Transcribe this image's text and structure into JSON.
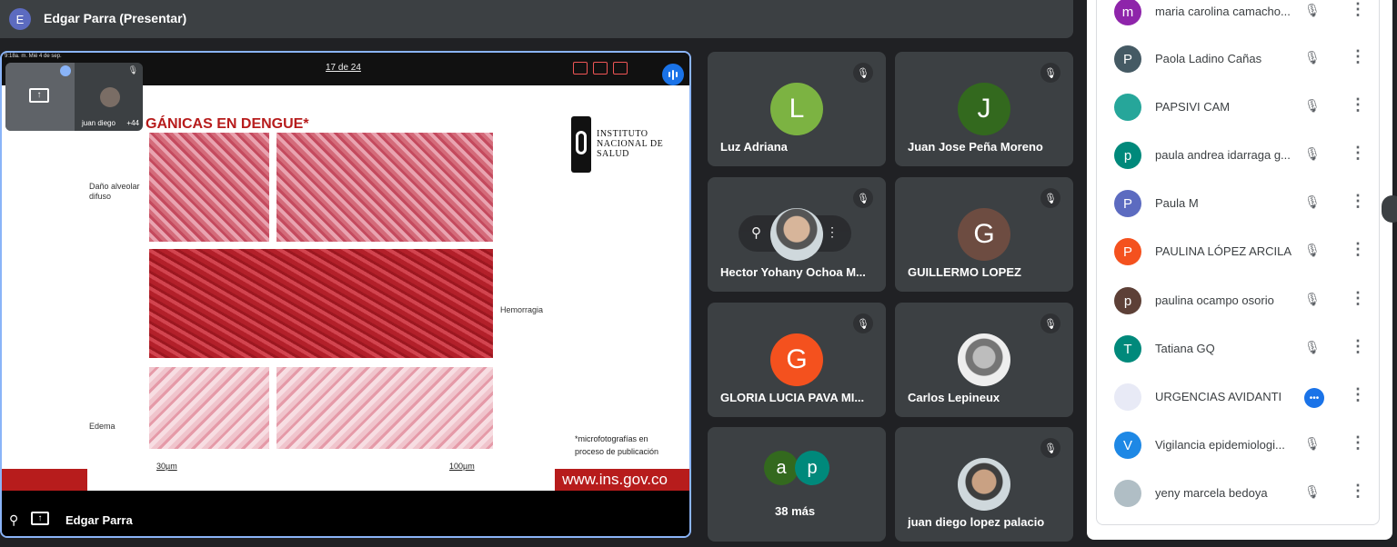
{
  "top_bar": {
    "avatar_letter": "E",
    "title": "Edgar Parra (Presentar)"
  },
  "presentation": {
    "device_time": "9:18a. m.   Mié 4 de sep.",
    "page_indicator": "17 de 24",
    "slide_title": "GÁNICAS EN DENGUE*",
    "logo_text": [
      "INSTITUTO",
      "NACIONAL DE",
      "SALUD"
    ],
    "annotations": {
      "dano": "Daño alveolar difuso",
      "hemorragia": "Hemorragia",
      "edema": "Edema"
    },
    "footnote": [
      "*microfotografías en",
      "proceso de publicación"
    ],
    "scale_left": "30µm",
    "scale_right": "100µm",
    "url": "www.ins.gov.co",
    "presenter_name": "Edgar Parra"
  },
  "self_view": {
    "label": "juan diego",
    "extra_count": "+44"
  },
  "tiles": [
    {
      "name": "Luz Adriana",
      "letter": "L",
      "color": "#7cb342"
    },
    {
      "name": "Juan Jose Peña Moreno",
      "letter": "J",
      "color": "#33691e"
    },
    {
      "name": "Hector Yohany Ochoa M...",
      "letter": "",
      "color": ""
    },
    {
      "name": "GUILLERMO LOPEZ",
      "letter": "G",
      "color": "#6d4c41"
    },
    {
      "name": "GLORIA LUCIA PAVA MI...",
      "letter": "G",
      "color": "#f4511e"
    },
    {
      "name": "Carlos Lepineux",
      "letter": "",
      "color": ""
    },
    {
      "name": "38 más",
      "letters": [
        "a",
        "p"
      ],
      "colors": [
        "#33691e",
        "#00897b"
      ]
    },
    {
      "name": "juan diego lopez palacio",
      "letter": "",
      "color": ""
    }
  ],
  "participants": [
    {
      "name": "maria carolina camacho...",
      "letter": "m",
      "color": "#8e24aa",
      "state": "muted"
    },
    {
      "name": "Paola Ladino Cañas",
      "letter": "P",
      "color": "#455a64",
      "state": "muted"
    },
    {
      "name": "PAPSIVI CAM",
      "letter": "",
      "color": "#26a69a",
      "state": "muted"
    },
    {
      "name": "paula andrea idarraga g...",
      "letter": "p",
      "color": "#00897b",
      "state": "muted"
    },
    {
      "name": "Paula M",
      "letter": "P",
      "color": "#5c6bc0",
      "state": "muted"
    },
    {
      "name": "PAULINA LÓPEZ ARCILA",
      "letter": "P",
      "color": "#f4511e",
      "state": "muted"
    },
    {
      "name": "paulina ocampo osorio",
      "letter": "p",
      "color": "#5d4037",
      "state": "muted"
    },
    {
      "name": "Tatiana GQ",
      "letter": "T",
      "color": "#00897b",
      "state": "muted"
    },
    {
      "name": "URGENCIAS AVIDANTI",
      "letter": "",
      "color": "#e8eaf6",
      "state": "speaking"
    },
    {
      "name": "Vigilancia epidemiologi...",
      "letter": "V",
      "color": "#1e88e5",
      "state": "muted"
    },
    {
      "name": "yeny marcela bedoya",
      "letter": "",
      "color": "#b0bec5",
      "state": "muted"
    }
  ],
  "icons": {
    "mute": "mic-off-icon",
    "more": "more-vert-icon",
    "pin": "pin-icon",
    "present": "present-screen-icon"
  }
}
